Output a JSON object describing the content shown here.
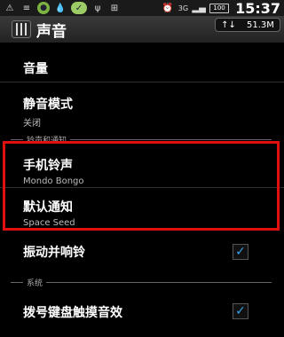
{
  "statusbar": {
    "clock": "15:37",
    "battery": "100",
    "signal": "3G",
    "icons": [
      "notification-icon",
      "settings-sliders-icon",
      "app-green-icon",
      "drop-icon",
      "app-lime-icon",
      "usb-icon",
      "shield-plus-icon",
      "alarm-clock-icon",
      "signal-icon"
    ]
  },
  "titlebar": {
    "title": "声音",
    "network_arrows": "↑↓",
    "network_speed": "51.3M"
  },
  "items": {
    "volume": {
      "label": "音量"
    },
    "silent": {
      "label": "静音模式",
      "value": "关闭"
    },
    "section_ringtone": "铃声和通知",
    "ringtone": {
      "label": "手机铃声",
      "value": "Mondo Bongo"
    },
    "notification": {
      "label": "默认通知",
      "value": "Space Seed"
    },
    "vibrate": {
      "label": "振动并响铃",
      "checked": true
    },
    "section_system": "系统",
    "dialpad": {
      "label": "拨号键盘触摸音效",
      "checked": true
    }
  },
  "colors": {
    "accent": "#39a0e8",
    "highlight": "#e01010"
  }
}
